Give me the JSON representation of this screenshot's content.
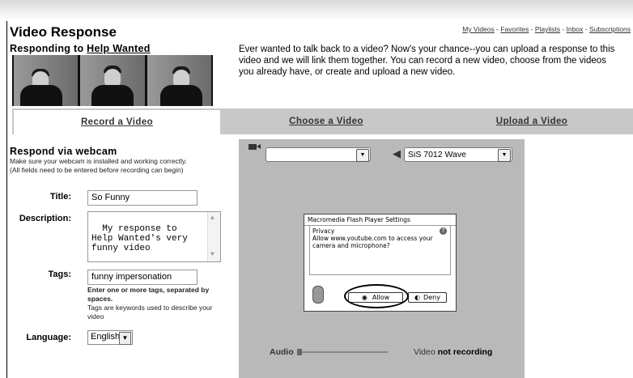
{
  "header": {
    "links": [
      "My Videos",
      "Favorites",
      "Playlists",
      "Inbox",
      "Subscriptions"
    ],
    "separator": " - "
  },
  "page": {
    "title": "Video Response",
    "responding_prefix": "Responding to ",
    "responding_video": "Help Wanted",
    "intro": "Ever wanted to talk back to a video? Now's your chance--you can upload a response to this video and we will link them together. You can record a new video, choose from the videos you already have, or create and upload a new video."
  },
  "tabs": [
    {
      "label": "Record a Video",
      "active": true
    },
    {
      "label": "Choose a Video",
      "active": false
    },
    {
      "label": "Upload a Video",
      "active": false
    }
  ],
  "form": {
    "heading": "Respond via webcam",
    "note_line1": "Make sure your webcam is installed and working correctly.",
    "note_line2": "(All fields need to be entered before recording can begin)",
    "title_label": "Title:",
    "title_value": "So Funny",
    "description_label": "Description:",
    "description_value": "My response to\nHelp Wanted's very\nfunny video",
    "tags_label": "Tags:",
    "tags_value": "funny impersonation",
    "tags_help_bold": "Enter one or more tags, separated by spaces.",
    "tags_help": "Tags are keywords used to describe your video",
    "language_label": "Language:",
    "language_value": "English"
  },
  "recorder": {
    "camera_value": "",
    "microphone_value": "SiS 7012 Wave",
    "audio_label": "Audio",
    "video_label": "Video",
    "video_status": "not recording",
    "flash": {
      "title": "Macromedia Flash Player Settings",
      "section": "Privacy",
      "message": "Allow www.youtube.com to access your camera and microphone?",
      "help_glyph": "?",
      "allow_label": "Allow",
      "deny_label": "Deny"
    }
  },
  "colors": {
    "tab_inactive": "#c8c8c8",
    "recorder_bg": "#b9b9b9"
  }
}
